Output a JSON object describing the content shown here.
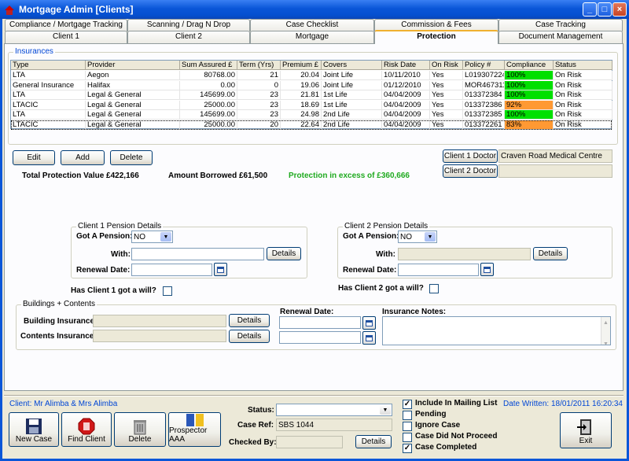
{
  "window": {
    "title": "Mortgage Admin [Clients]"
  },
  "tabs_row1": [
    "Compliance / Mortgage Tracking",
    "Scanning / Drag N Drop",
    "Case Checklist",
    "Commission & Fees",
    "Case Tracking"
  ],
  "tabs_row2": [
    "Client 1",
    "Client 2",
    "Mortgage",
    "Protection",
    "Document Management"
  ],
  "active_tab": "Protection",
  "insurances": {
    "group_label": "Insurances",
    "columns": [
      "Type",
      "Provider",
      "Sum Assured £",
      "Term (Yrs)",
      "Premium £",
      "Covers",
      "Risk Date",
      "On Risk",
      "Policy #",
      "Compliance",
      "Status"
    ],
    "rows": [
      [
        "LTA",
        "Aegon",
        "80768.00",
        "21",
        "20.04",
        "Joint Life",
        "10/11/2010",
        "Yes",
        "L019307224",
        "100%",
        "On Risk"
      ],
      [
        "General Insurance",
        "Halifax",
        "0.00",
        "0",
        "19.06",
        "Joint Life",
        "01/12/2010",
        "Yes",
        "MOR467311",
        "100%",
        "On Risk"
      ],
      [
        "LTA",
        "Legal & General",
        "145699.00",
        "23",
        "21.81",
        "1st Life",
        "04/04/2009",
        "Yes",
        "013372384",
        "100%",
        "On Risk"
      ],
      [
        "LTACIC",
        "Legal & General",
        "25000.00",
        "23",
        "18.69",
        "1st Life",
        "04/04/2009",
        "Yes",
        "013372386",
        "92%",
        "On Risk"
      ],
      [
        "LTA",
        "Legal & General",
        "145699.00",
        "23",
        "24.98",
        "2nd Life",
        "04/04/2009",
        "Yes",
        "013372385",
        "100%",
        "On Risk"
      ],
      [
        "LTACIC",
        "Legal & General",
        "25000.00",
        "20",
        "22.64",
        "2nd Life",
        "04/04/2009",
        "Yes",
        "013372261",
        "83%",
        "On Risk"
      ]
    ],
    "compliance_colors": {
      "full": "#00e000",
      "partial": "#ff9933"
    }
  },
  "buttons": {
    "edit": "Edit",
    "add": "Add",
    "delete": "Delete",
    "client1_doctor": "Client 1 Doctor",
    "client2_doctor": "Client 2 Doctor",
    "details": "Details"
  },
  "doctors": {
    "client1": "Craven Road Medical Centre",
    "client2": ""
  },
  "totals": {
    "protection": "Total Protection Value £422,166",
    "borrowed": "Amount Borrowed £61,500",
    "excess": "Protection in excess of £360,666"
  },
  "pension1": {
    "group_label": "Client 1 Pension Details",
    "got_label": "Got A Pension:",
    "got_value": "NO",
    "with_label": "With:",
    "with_value": "",
    "renewal_label": "Renewal Date:",
    "renewal_value": ""
  },
  "pension2": {
    "group_label": "Client 2 Pension Details",
    "got_label": "Got A Pension:",
    "got_value": "NO",
    "with_label": "With:",
    "with_value": "",
    "renewal_label": "Renewal Date:",
    "renewal_value": ""
  },
  "will1": "Has Client 1 got a will?",
  "will2": "Has Client 2 got a will?",
  "buildings": {
    "group_label": "Buildings + Contents",
    "building_label": "Building Insurance:",
    "contents_label": "Contents Insurance:",
    "renewal_label": "Renewal Date:",
    "notes_label": "Insurance Notes:"
  },
  "footer": {
    "client": "Client: Mr Alimba & Mrs Alimba",
    "date_written": "Date Written: 18/01/2011 16:20:34",
    "status_label": "Status:",
    "status_value": "",
    "case_ref_label": "Case Ref:",
    "case_ref_value": "SBS 1044",
    "checked_by_label": "Checked By:",
    "checked_by_value": "",
    "details": "Details",
    "big_buttons": {
      "new_case": "New Case",
      "find_client": "Find Client",
      "delete": "Delete",
      "prospector": "Prospector AAA",
      "exit": "Exit"
    },
    "checks": [
      {
        "label": "Include In Mailing List",
        "checked": true
      },
      {
        "label": "Pending",
        "checked": false
      },
      {
        "label": "Ignore Case",
        "checked": false
      },
      {
        "label": "Case Did Not Proceed",
        "checked": false
      },
      {
        "label": "Case Completed",
        "checked": true
      }
    ]
  }
}
